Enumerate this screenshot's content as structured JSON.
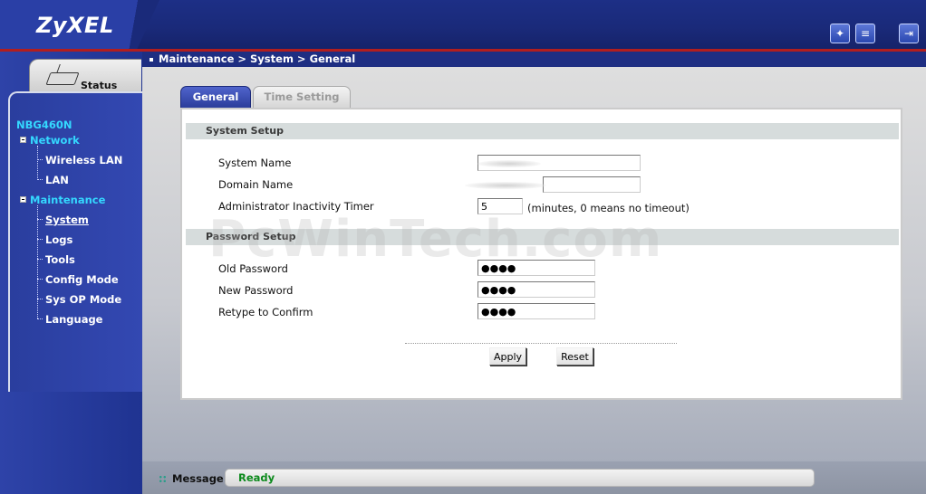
{
  "header": {
    "logo": "ZyXEL",
    "icons": [
      "wizard-icon",
      "notes-icon",
      "logout-icon"
    ]
  },
  "sidebar": {
    "status_tab": "Status",
    "device": "NBG460N",
    "groups": [
      {
        "label": "Network",
        "items": [
          "Wireless LAN",
          "LAN"
        ]
      },
      {
        "label": "Maintenance",
        "items": [
          "System",
          "Logs",
          "Tools",
          "Config Mode",
          "Sys OP Mode",
          "Language"
        ]
      }
    ],
    "active_item": "System"
  },
  "breadcrumb": "Maintenance > System > General",
  "tabs": [
    {
      "label": "General",
      "active": true
    },
    {
      "label": "Time Setting",
      "active": false
    }
  ],
  "system_setup": {
    "title": "System Setup",
    "system_name_label": "System Name",
    "system_name_value": "",
    "domain_name_label": "Domain Name",
    "domain_name_value": "",
    "timer_label": "Administrator Inactivity Timer",
    "timer_value": "5",
    "timer_suffix": "(minutes, 0 means no timeout)"
  },
  "password_setup": {
    "title": "Password Setup",
    "old_label": "Old Password",
    "old_value": "●●●●",
    "new_label": "New Password",
    "new_value": "●●●●",
    "retype_label": "Retype to Confirm",
    "retype_value": "●●●●"
  },
  "buttons": {
    "apply": "Apply",
    "reset": "Reset"
  },
  "status_bar": {
    "label": "Message",
    "value": "Ready"
  },
  "watermark": "PcWinTech.com",
  "colors": {
    "accent": "#1e2e82",
    "nav_highlight": "#34d8ff",
    "ready": "#0c8a1c",
    "header_rule": "#b21e1e"
  }
}
